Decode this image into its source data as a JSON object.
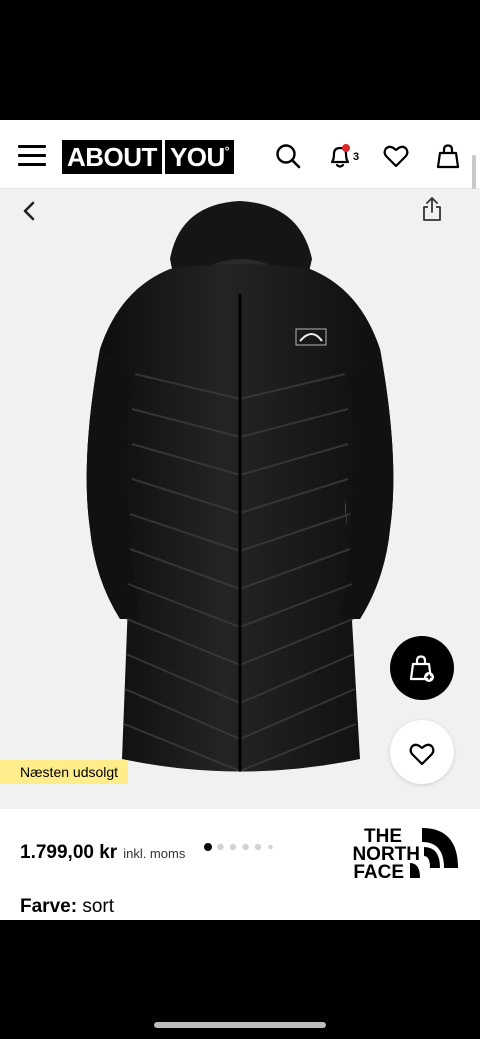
{
  "header": {
    "logo_left": "ABOUT",
    "logo_right": "YOU",
    "logo_mark": "°",
    "notification_count": "3",
    "icons": [
      "menu-icon",
      "search-icon",
      "bell-icon",
      "heart-icon",
      "bag-icon"
    ]
  },
  "gallery": {
    "badge": "Næsten udsolgt",
    "image_count": 6,
    "active_index": 0
  },
  "product": {
    "price": "1.799,00 kr",
    "price_note": "inkl. moms",
    "brand_line1": "THE",
    "brand_line2": "NORTH",
    "brand_line3": "FACE",
    "color_label": "Farve:",
    "color_value": "sort"
  },
  "colors": {
    "badge_bg": "#ffed8c",
    "gallery_bg": "#f1f1f1",
    "notification_dot": "#e0242b"
  }
}
